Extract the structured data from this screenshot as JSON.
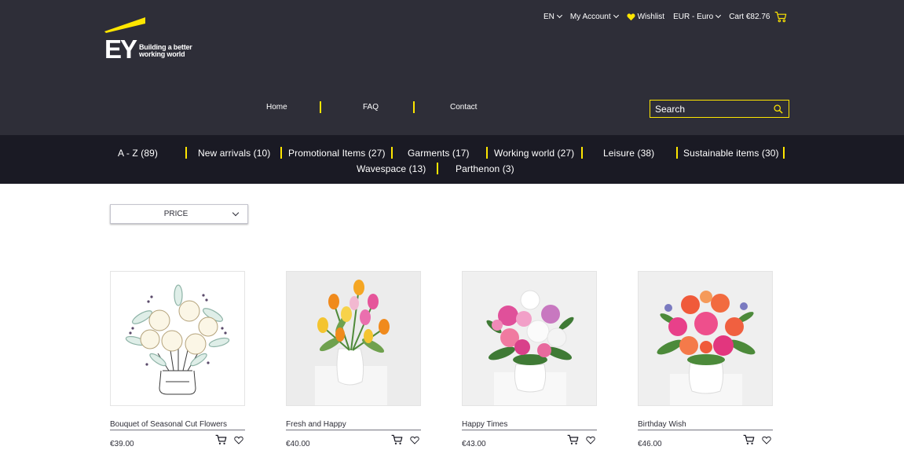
{
  "brand": {
    "logo_letters": "EY",
    "tagline_line1": "Building a better",
    "tagline_line2": "working world",
    "accent": "#ffe600",
    "dark": "#2e2e38"
  },
  "utility": {
    "language": "EN",
    "account": "My Account",
    "wishlist": "Wishlist",
    "currency": "EUR - Euro",
    "cart": "Cart €82.76"
  },
  "nav": {
    "home": "Home",
    "faq": "FAQ",
    "contact": "Contact"
  },
  "search": {
    "placeholder": "Search"
  },
  "categories": [
    "A - Z (89)",
    "New arrivals (10)",
    "Promotional Items (27)",
    "Garments (17)",
    "Working world (27)",
    "Leisure (38)",
    "Sustainable items (30)",
    "Wavespace (13)",
    "Parthenon (3)"
  ],
  "filter": {
    "label": "PRICE"
  },
  "products": [
    {
      "name": "Bouquet of Seasonal Cut Flowers",
      "price": "€39.00"
    },
    {
      "name": "Fresh and Happy",
      "price": "€40.00"
    },
    {
      "name": "Happy Times",
      "price": "€43.00"
    },
    {
      "name": "Birthday Wish",
      "price": "€46.00"
    }
  ]
}
